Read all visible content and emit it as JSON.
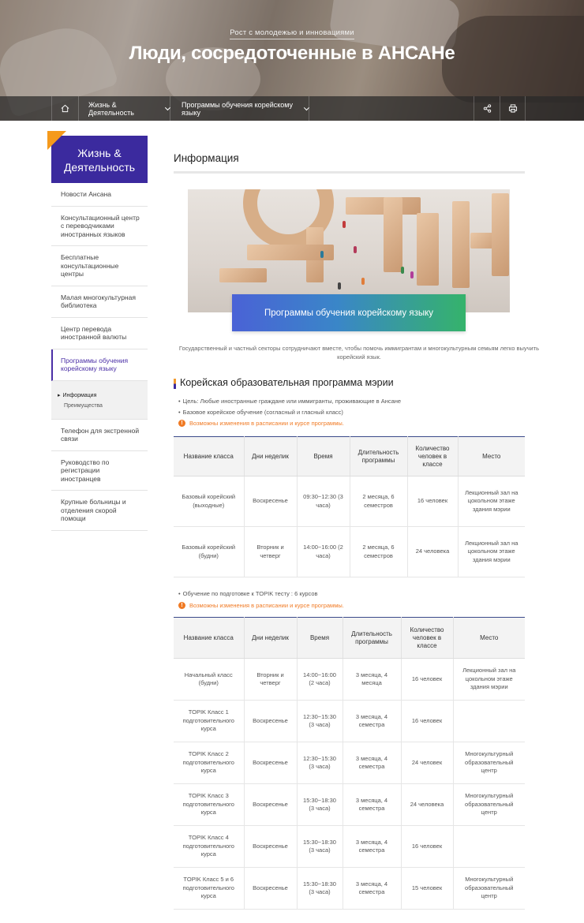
{
  "hero": {
    "subtitle": "Рост с молодежью и инновациями",
    "title": "Люди, сосредоточенные в АНСАНе"
  },
  "nav": {
    "home_icon": "home-icon",
    "menu1": "Жизнь & Деятельность",
    "menu2": "Программы обучения корейскому языку",
    "share_icon": "share-icon",
    "print_icon": "print-icon"
  },
  "sidebar": {
    "heading": "Жизнь & Деятельность",
    "items": [
      {
        "label": "Новости Ансана"
      },
      {
        "label": "Консультационный центр с переводчиками иностранных языков"
      },
      {
        "label": "Бесплатные консультационные центры"
      },
      {
        "label": "Малая многокультурная библиотека"
      },
      {
        "label": "Центр перевода иностранной валюты"
      },
      {
        "label": "Программы обучения корейскому языку"
      },
      {
        "label": "Телефон для экстренной связи"
      },
      {
        "label": "Руководство по регистрации иностранцев"
      },
      {
        "label": "Крупные больницы и отделения скорой помощи"
      }
    ],
    "sub": {
      "current": "Информация",
      "other": "Преимущества"
    }
  },
  "main": {
    "title": "Информация",
    "banner_label": "Программы обучения корейскому языку",
    "intro": "Государственный и частный секторы сотрудничают вместе, чтобы помочь иммигрантам и многокультурным семьям легко выучить корейский язык.",
    "section_title": "Корейская образовательная программа мэрии",
    "bullet1": "Цель: Любые иностранные граждане или иммигранты, проживающие в Ансане",
    "bullet2": "Базовое корейское обучение (согласный и гласный класс)",
    "warning": "Возможны изменения в расписании и курсе программы.",
    "topik_bullet": "Обучение по подготовке к TOPIK тесту : 6 курсов",
    "colors": {
      "accent": "#3b2a9e",
      "warn": "#f07a24",
      "orange": "#f59a1c"
    }
  },
  "table1": {
    "headers": [
      "Название класса",
      "Дни неделик",
      "Время",
      "Длительность программы",
      "Количество человек в классе",
      "Место"
    ],
    "rows": [
      [
        "Базовый корейский (выходные)",
        "Воскресенье",
        "09:30~12:30 (3 часа)",
        "2 месяца, 6 семестров",
        "16 человек",
        "Лекционный зал на цокольном этаже здания мэрии"
      ],
      [
        "Базовый корейский (будни)",
        "Вторник и четверг",
        "14:00~16:00 (2 часа)",
        "2 месяца, 6 семестров",
        "24 человека",
        "Лекционный зал на цокольном этаже здания мэрии"
      ]
    ]
  },
  "table2": {
    "headers": [
      "Название класса",
      "Дни неделик",
      "Время",
      "Длительность программы",
      "Количество человек в классе",
      "Место"
    ],
    "rows": [
      [
        "Начальный класс (будни)",
        "Вторник и четверг",
        "14:00~16:00 (2 часа)",
        "3 месяца, 4 месяца",
        "16 человек",
        "Лекционный зал на цокольном этаже здания мэрии"
      ],
      [
        "TOPIK Класс 1 подготовительного курса",
        "Воскресенье",
        "12:30~15:30 (3 часа)",
        "3 месяца, 4 семестра",
        "16 человек",
        ""
      ],
      [
        "TOPIK Класс 2 подготовительного курса",
        "Воскресенье",
        "12:30~15:30 (3 часа)",
        "3 месяца, 4 семестра",
        "24 человек",
        "Многокультурный образовательный центр"
      ],
      [
        "TOPIK Класс 3 подготовительного курса",
        "Воскресенье",
        "15:30~18:30 (3 часа)",
        "3 месяца, 4 семестра",
        "24 человека",
        "Многокультурный образовательный центр"
      ],
      [
        "TOPIK Класс 4 подготовительного курса",
        "Воскресенье",
        "15:30~18:30 (3 часа)",
        "3 месяца, 4 семестра",
        "16 человек",
        ""
      ],
      [
        "TOPIK Класс 5 и 6 подготовительного курса",
        "Воскресенье",
        "15:30~18:30 (3 часа)",
        "3 месяца, 4 семестра",
        "15 человек",
        "Многокультурный образовательный центр"
      ]
    ]
  }
}
